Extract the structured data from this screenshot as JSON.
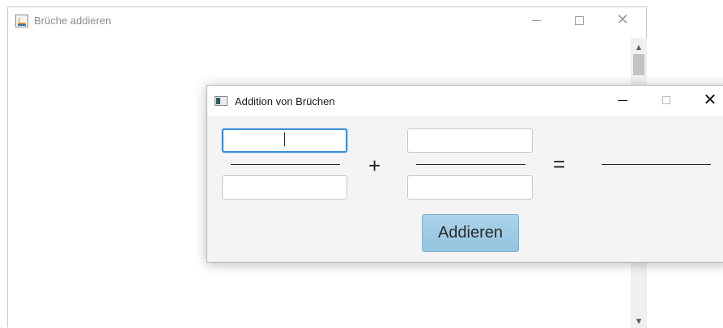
{
  "background_window": {
    "title": "Brüche addieren",
    "icons": {
      "app": "java-coffee-icon",
      "minimize": "minimize-icon",
      "maximize": "maximize-icon",
      "close": "close-icon"
    },
    "scrollbar": {
      "up_arrow": "chevron-up-icon",
      "down_arrow": "chevron-down-icon"
    }
  },
  "dialog": {
    "title": "Addition von Brüchen",
    "icons": {
      "app": "window-icon",
      "minimize": "minimize-icon",
      "maximize": "maximize-icon",
      "close": "close-icon"
    },
    "fraction1": {
      "numerator": "",
      "denominator": ""
    },
    "fraction2": {
      "numerator": "",
      "denominator": ""
    },
    "plus_sign": "+",
    "equals_sign": "=",
    "result": "",
    "add_button_label": "Addieren",
    "colors": {
      "focus_border": "#3a8fd6",
      "button_bg": "#a3cde6"
    }
  }
}
